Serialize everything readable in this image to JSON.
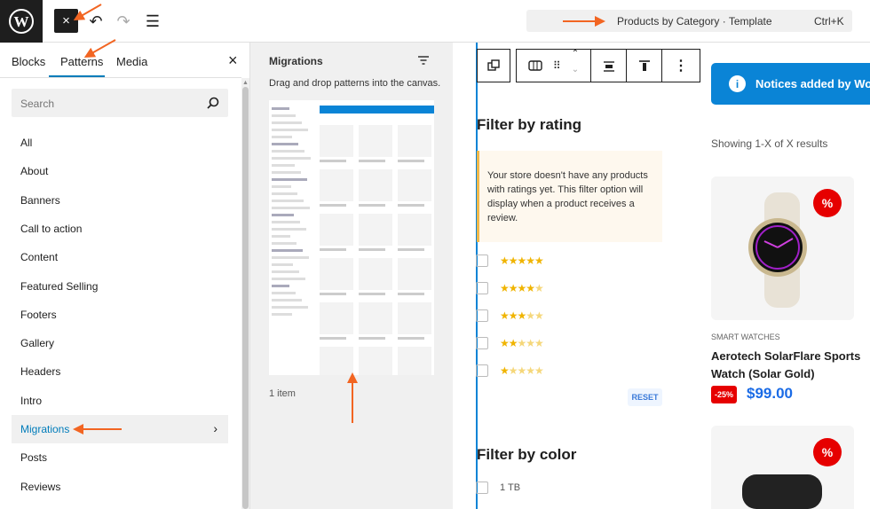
{
  "topbar": {
    "close": "×",
    "undo": "↶",
    "redo": "↷",
    "list": "☰",
    "command_title": "Products by Category · Template",
    "shortcut": "Ctrl+K"
  },
  "inserter": {
    "tabs": [
      "Blocks",
      "Patterns",
      "Media"
    ],
    "close": "×",
    "search_placeholder": "Search",
    "categories": [
      "All",
      "About",
      "Banners",
      "Call to action",
      "Content",
      "Featured Selling",
      "Footers",
      "Gallery",
      "Headers",
      "Intro",
      "Migrations",
      "Posts",
      "Reviews"
    ],
    "active_category": "Migrations"
  },
  "patterns": {
    "title": "Migrations",
    "description": "Drag and drop patterns into the canvas.",
    "count": "1 item"
  },
  "canvas": {
    "filter_rating_title": "Filter by rating",
    "notice_text": "Your store doesn't have any products with ratings yet. This filter option will display when a product receives a review.",
    "ratings": [
      5,
      4,
      3,
      2,
      1
    ],
    "reset": "RESET",
    "filter_color_title": "Filter by color",
    "color_option": "1 TB",
    "notice_banner": "Notices added by WooC",
    "results": "Showing 1-X of X results",
    "product": {
      "category": "SMART WATCHES",
      "name": "Aerotech SolarFlare Sports Watch (Solar Gold)",
      "discount": "-25%",
      "price": "$99.00",
      "badge": "%"
    }
  },
  "colors": {
    "accent": "#007cba",
    "arrow": "#f26522",
    "sale": "#e60000",
    "price": "#1a6be6"
  }
}
